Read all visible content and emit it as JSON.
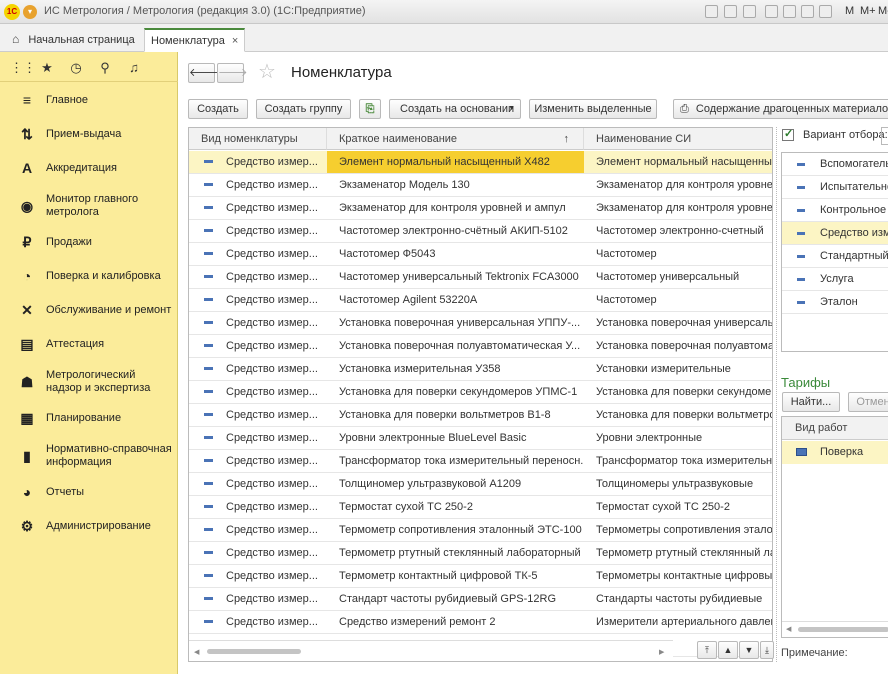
{
  "window": {
    "title": "ИС Метрология / Метрология (редакция 3.0)  (1С:Предприятие)",
    "right_buttons": [
      "M",
      "M+",
      "M-"
    ]
  },
  "tabs": [
    {
      "label": "Начальная страница"
    },
    {
      "label": "Номенклатура",
      "close": "×"
    }
  ],
  "sidebar": {
    "items": [
      {
        "label": "Главное",
        "icon": "hamburger-icon"
      },
      {
        "label": "Прием-выдача",
        "icon": "transfer-icon"
      },
      {
        "label": "Аккредитация",
        "icon": "letter-a-icon"
      },
      {
        "label": "Монитор главного метролога",
        "icon": "eye-icon"
      },
      {
        "label": "Продажи",
        "icon": "coin-icon"
      },
      {
        "label": "Поверка и калибровка",
        "icon": "stopwatch-icon"
      },
      {
        "label": "Обслуживание и ремонт",
        "icon": "tools-icon"
      },
      {
        "label": "Аттестация",
        "icon": "certificate-icon"
      },
      {
        "label": "Метрологический надзор и экспертиза",
        "icon": "inspector-icon"
      },
      {
        "label": "Планирование",
        "icon": "calendar-icon"
      },
      {
        "label": "Нормативно-справочная информация",
        "icon": "book-icon"
      },
      {
        "label": "Отчеты",
        "icon": "pie-chart-icon"
      },
      {
        "label": "Администрирование",
        "icon": "gears-icon"
      }
    ]
  },
  "page": {
    "title": "Номенклатура"
  },
  "toolbar": {
    "create": "Создать",
    "create_group": "Создать группу",
    "create_based_on": "Создать на основании",
    "edit_selected": "Изменить выделенные",
    "precious_metals": "Содержание драгоценных материалов"
  },
  "grid": {
    "columns": [
      "Вид номенклатуры",
      "Краткое наименование",
      "Наименование СИ"
    ],
    "sort_indicator": "↑",
    "rows": [
      [
        "Средство измер...",
        "Элемент нормальный насыщенный Х482",
        "Элемент нормальный насыщенный"
      ],
      [
        "Средство измер...",
        "Экзаменатор Модель 130",
        "Экзаменатор для контроля уровней и"
      ],
      [
        "Средство измер...",
        "Экзаменатор для контроля уровней и ампул",
        "Экзаменатор для контроля уровней и"
      ],
      [
        "Средство измер...",
        "Частотомер электронно-счётный АКИП-5102",
        "Частотомер электронно-счетный"
      ],
      [
        "Средство измер...",
        "Частотомер Ф5043",
        "Частотомер"
      ],
      [
        "Средство измер...",
        "Частотомер универсальный Tektronix FCA3000",
        "Частотомер универсальный"
      ],
      [
        "Средство измер...",
        "Частотомер Agilent 53220A",
        "Частотомер"
      ],
      [
        "Средство измер...",
        "Установка поверочная универсальная УППУ-...",
        "Установка поверочная универсальная"
      ],
      [
        "Средство измер...",
        "Установка поверочная полуавтоматическая У...",
        "Установка поверочная полуавтомати"
      ],
      [
        "Средство измер...",
        "Установка измерительная У358",
        "Установки измерительные"
      ],
      [
        "Средство измер...",
        "Установка для поверки секундомеров УПМС-1",
        "Установка для поверки секундомеров"
      ],
      [
        "Средство измер...",
        "Установка для поверки вольтметров В1-8",
        "Установка для поверки вольтметров"
      ],
      [
        "Средство измер...",
        "Уровни электронные BlueLevel Basic",
        "Уровни электронные"
      ],
      [
        "Средство измер...",
        "Трансформатор тока измерительный переносн...",
        "Трансформатор тока измерительный"
      ],
      [
        "Средство измер...",
        "Толщиномер ультразвуковой А1209",
        "Толщиномеры ультразвуковые"
      ],
      [
        "Средство измер...",
        "Термостат сухой ТС 250-2",
        "Термостат сухой ТС 250-2"
      ],
      [
        "Средство измер...",
        "Термометр сопротивления эталонный ЭТС-100",
        "Термометры сопротивления эталонн"
      ],
      [
        "Средство измер...",
        "Термометр ртутный стеклянный лабораторный ...",
        "Термометр ртутный стеклянный лабор"
      ],
      [
        "Средство измер...",
        "Термометр контактный цифровой ТК-5",
        "Термометры контактные цифровые"
      ],
      [
        "Средство измер...",
        "Стандарт частоты рубидиевый GPS-12RG",
        "Стандарты частоты рубидиевые"
      ],
      [
        "Средство измер...",
        "Средство измерений ремонт 2",
        "Измерители артериального давления"
      ]
    ]
  },
  "filter": {
    "checkbox_label": "Вариант отбора:",
    "checked": true
  },
  "kinds": {
    "items": [
      "Вспомогатель",
      "Испытательно",
      "Контрольное о",
      "Средство изме",
      "Стандартный о",
      "Услуга",
      "Эталон"
    ]
  },
  "tariffs": {
    "title": "Тарифы",
    "find_button": "Найти...",
    "cancel_button": "Отмен",
    "column": "Вид работ",
    "rows": [
      "Поверка"
    ]
  },
  "note": {
    "label": "Примечание:"
  },
  "colors": {
    "sidebar": "#fbec9a",
    "selection": "#f6ce2f",
    "accent_green": "#4a8a3c"
  }
}
